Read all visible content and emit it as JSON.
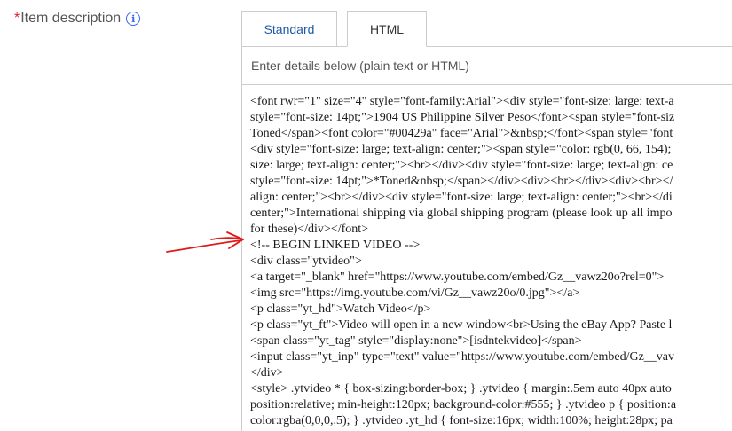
{
  "field": {
    "required_mark": "*",
    "label": "Item description",
    "info_glyph": "i"
  },
  "tabs": [
    {
      "label": "Standard",
      "active": false
    },
    {
      "label": "HTML",
      "active": true
    }
  ],
  "editor": {
    "hint": "Enter details below (plain text or HTML)",
    "lines": [
      "<font rwr=\"1\" size=\"4\" style=\"font-family:Arial\"><div style=\"font-size: large; text-a",
      "style=\"font-size: 14pt;\">1904 US Philippine Silver Peso</font><span style=\"font-siz",
      "Toned</span><font color=\"#00429a\" face=\"Arial\">&nbsp;</font><span style=\"font",
      "<div style=\"font-size: large; text-align: center;\"><span style=\"color: rgb(0, 66, 154);",
      "size: large; text-align: center;\"><br></div><div style=\"font-size: large; text-align: ce",
      "style=\"font-size: 14pt;\">*Toned&nbsp;</span></div><div><br></div><div><br></",
      "align: center;\"><br></div><div style=\"font-size: large; text-align: center;\"><br></di",
      "center;\">International shipping via global shipping program (please look up all impo",
      "for these)</div></font>",
      "<!-- BEGIN LINKED VIDEO -->",
      "<div class=\"ytvideo\">",
      "<a target=\"_blank\" href=\"https://www.youtube.com/embed/Gz__vawz20o?rel=0\">",
      "<img src=\"https://img.youtube.com/vi/Gz__vawz20o/0.jpg\"></a>",
      "<p class=\"yt_hd\">Watch Video</p>",
      "<p class=\"yt_ft\">Video will open in a new window<br>Using the eBay App? Paste l",
      "<span class=\"yt_tag\" style=\"display:none\">[isdntekvideo]</span>",
      "<input class=\"yt_inp\" type=\"text\" value=\"https://www.youtube.com/embed/Gz__vav",
      "</div>",
      "<style> .ytvideo * { box-sizing:border-box; } .ytvideo { margin:.5em auto 40px auto",
      "position:relative; min-height:120px; background-color:#555; } .ytvideo p { position:a",
      "color:rgba(0,0,0,.5); } .ytvideo .yt_hd { font-size:16px; width:100%; height:28px; pa"
    ]
  },
  "colors": {
    "required": "#dd1e31",
    "link_blue": "#1e5aa8",
    "info_icon": "#3665f3",
    "annotation_arrow": "#e01818",
    "border": "#cccccc"
  }
}
